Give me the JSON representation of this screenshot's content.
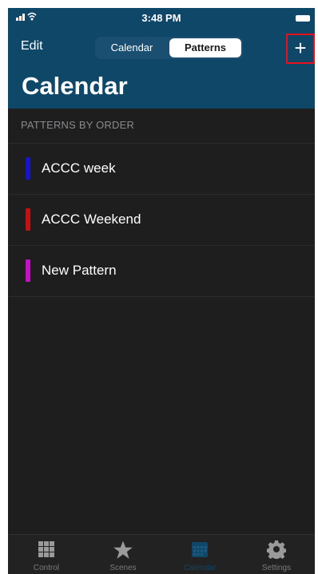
{
  "status_bar": {
    "time": "3:48 PM"
  },
  "nav": {
    "edit_label": "Edit",
    "segments": [
      "Calendar",
      "Patterns"
    ],
    "selected_segment": "Patterns",
    "add_label": "+",
    "title": "Calendar"
  },
  "section": {
    "header": "PATTERNS BY ORDER"
  },
  "patterns": [
    {
      "label": "ACCC  week",
      "color": "#1616c8"
    },
    {
      "label": "ACCC Weekend",
      "color": "#c41212"
    },
    {
      "label": "New Pattern",
      "color": "#c511c5"
    }
  ],
  "tabbar": {
    "tabs": [
      {
        "label": "Control",
        "icon": "grid-icon"
      },
      {
        "label": "Scenes",
        "icon": "star-icon"
      },
      {
        "label": "Calendar",
        "icon": "calendar-icon",
        "active": true
      },
      {
        "label": "Settings",
        "icon": "gear-icon"
      }
    ]
  },
  "colors": {
    "nav_bar": "#0f4769",
    "background": "#1e1e1e",
    "highlight": "#e8101a"
  }
}
